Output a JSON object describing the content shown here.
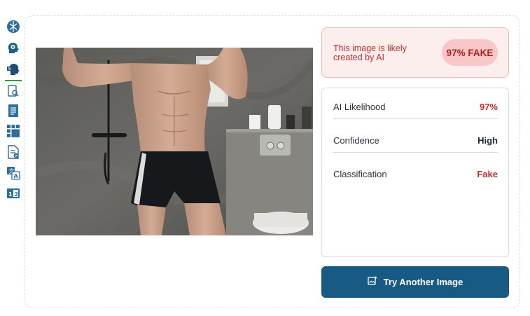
{
  "sidebar": {
    "items": [
      {
        "icon": "brain-icon"
      },
      {
        "icon": "head-gear-icon"
      },
      {
        "icon": "ai-head-icon"
      },
      {
        "icon": "document-search-icon"
      },
      {
        "icon": "document-list-icon"
      },
      {
        "icon": "image-grid-icon"
      },
      {
        "icon": "document-check-icon"
      },
      {
        "icon": "translate-icon"
      },
      {
        "icon": "compare-icon"
      }
    ],
    "active_index": 2
  },
  "image": {
    "subject": "uploaded-photo"
  },
  "result": {
    "verdict_text": "This image is likely created by AI",
    "badge": "97% FAKE",
    "accent_color": "#c22d2d"
  },
  "stats": [
    {
      "label": "AI Likelihood",
      "value": "97%",
      "color": "#c22d2d"
    },
    {
      "label": "Confidence",
      "value": "High",
      "color": "#1f2a37"
    },
    {
      "label": "Classification",
      "value": "Fake",
      "color": "#c22d2d"
    }
  ],
  "actions": {
    "try_another": "Try Another Image",
    "button_color": "#175a83"
  }
}
